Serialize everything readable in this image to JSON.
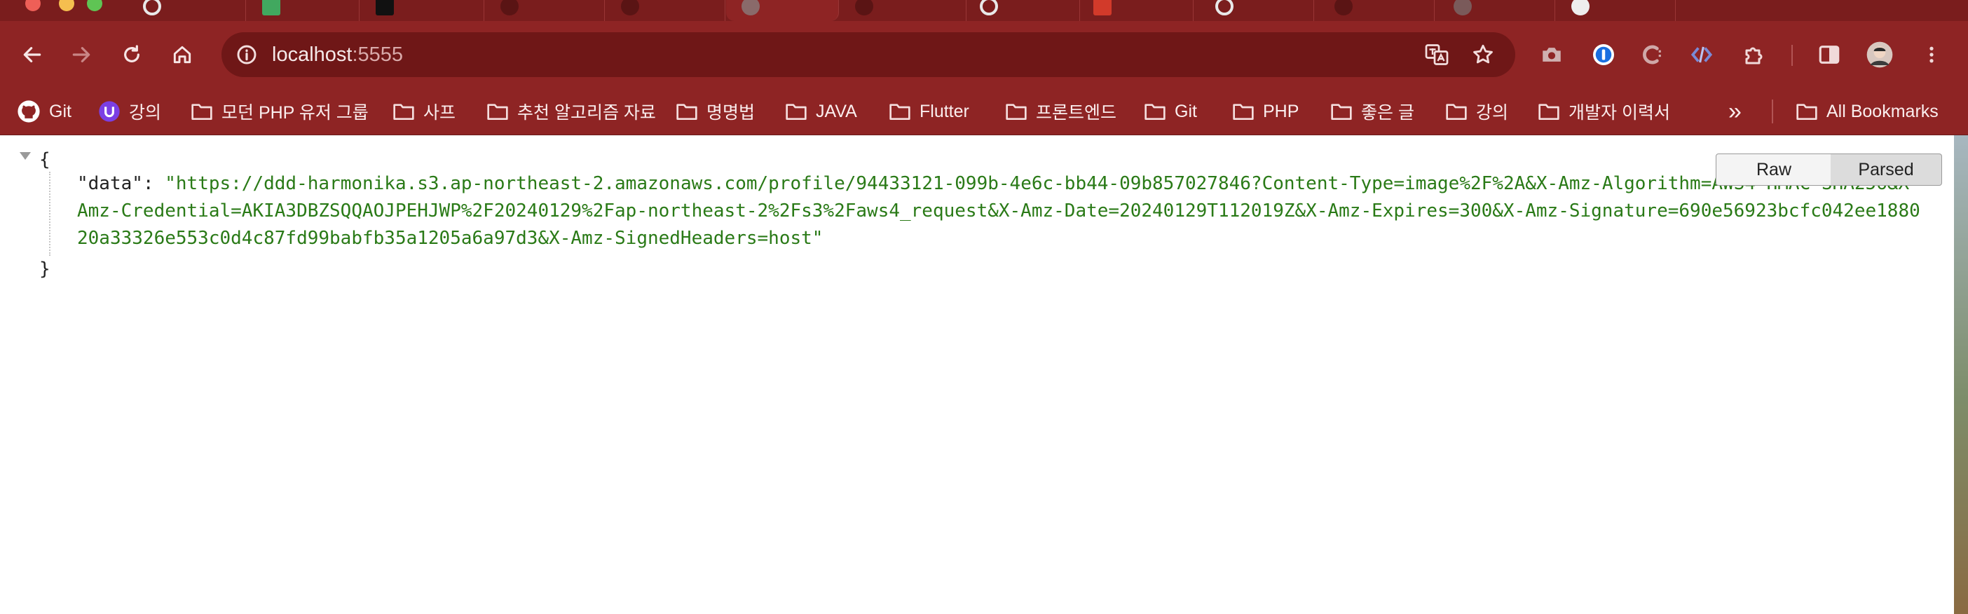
{
  "browser": {
    "address_bar": {
      "host": "localhost",
      "port": ":5555"
    },
    "bookmarks": [
      {
        "label": "Git",
        "icon": "github-icon"
      },
      {
        "label": "강의",
        "icon": "purple-circle-icon"
      },
      {
        "label": "모던 PHP 유저 그룹",
        "icon": "folder-icon"
      },
      {
        "label": "사프",
        "icon": "folder-icon"
      },
      {
        "label": "추천 알고리즘 자료",
        "icon": "folder-icon"
      },
      {
        "label": "명명법",
        "icon": "folder-icon"
      },
      {
        "label": "JAVA",
        "icon": "folder-icon"
      },
      {
        "label": "Flutter",
        "icon": "folder-icon"
      },
      {
        "label": "프론트엔드",
        "icon": "folder-icon"
      },
      {
        "label": "Git",
        "icon": "folder-icon"
      },
      {
        "label": "PHP",
        "icon": "folder-icon"
      },
      {
        "label": "좋은 글",
        "icon": "folder-icon"
      },
      {
        "label": "강의",
        "icon": "folder-icon"
      },
      {
        "label": "개발자 이력서",
        "icon": "folder-icon"
      }
    ],
    "overflow_label": "»",
    "all_bookmarks_label": "All Bookmarks",
    "colors": {
      "frame": "#8e2424",
      "tabstrip": "#7a1d1d",
      "omnibox": "#6f1717"
    }
  },
  "json_viewer": {
    "open_brace": "{",
    "close_brace": "}",
    "key": "\"data\"",
    "colon": ": ",
    "value": "\"https://ddd-harmonika.s3.ap-northeast-2.amazonaws.com/profile/94433121-099b-4e6c-bb44-09b857027846?Content-Type=image%2F%2A&X-Amz-Algorithm=AWS4-HMAC-SHA256&X-Amz-Credential=AKIA3DBZSQQAOJPEHJWP%2F20240129%2Fap-northeast-2%2Fs3%2Faws4_request&X-Amz-Date=20240129T112019Z&X-Amz-Expires=300&X-Amz-Signature=690e56923bcfc042ee188020a33326e553c0d4c87fd99babfb35a1205a6a97d3&X-Amz-SignedHeaders=host\"",
    "raw_label": "Raw",
    "parsed_label": "Parsed",
    "colors": {
      "string": "#2a7a17",
      "key": "#222222"
    }
  }
}
